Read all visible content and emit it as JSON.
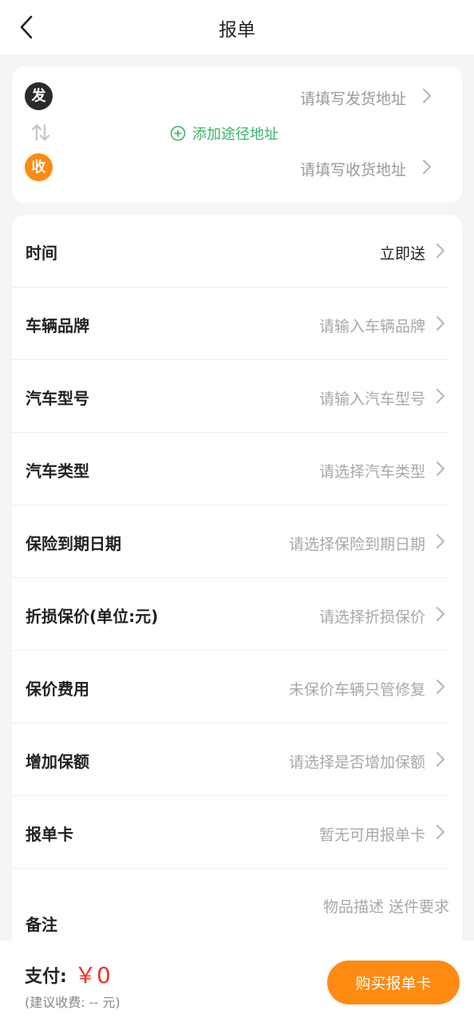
{
  "header": {
    "title": "报单",
    "back_icon": "chevron-left-icon"
  },
  "address": {
    "sender_badge": "发",
    "sender_placeholder": "请填写发货地址",
    "receiver_badge": "收",
    "receiver_placeholder": "请填写收货地址",
    "add_waypoint_label": "添加途径地址",
    "colors": {
      "sender_badge": "#2b2b2b",
      "receiver_badge": "#ff8a12",
      "waypoint": "#3ab46a"
    }
  },
  "form": {
    "rows": [
      {
        "label": "时间",
        "value": "立即送"
      },
      {
        "label": "车辆品牌",
        "value": "请输入车辆品牌"
      },
      {
        "label": "汽车型号",
        "value": "请输入汽车型号"
      },
      {
        "label": "汽车类型",
        "value": "请选择汽车类型"
      },
      {
        "label": "保险到期日期",
        "value": "请选择保险到期日期"
      },
      {
        "label": "折损保价(单位:元)",
        "value": "请选择折损保价"
      },
      {
        "label": "保价费用",
        "value": "未保价车辆只管修复"
      },
      {
        "label": "增加保额",
        "value": "请选择是否增加保额"
      },
      {
        "label": "报单卡",
        "value": "暂无可用报单卡"
      }
    ],
    "remark": {
      "label": "备注",
      "placeholder": "物品描述 送件要求"
    }
  },
  "footer": {
    "pay_label": "支付:",
    "amount": "￥0",
    "hint": "(建议收费: -- 元)",
    "buy_button": "购买报单卡",
    "colors": {
      "accent": "#ff8a12",
      "amount": "#f0332a"
    }
  }
}
